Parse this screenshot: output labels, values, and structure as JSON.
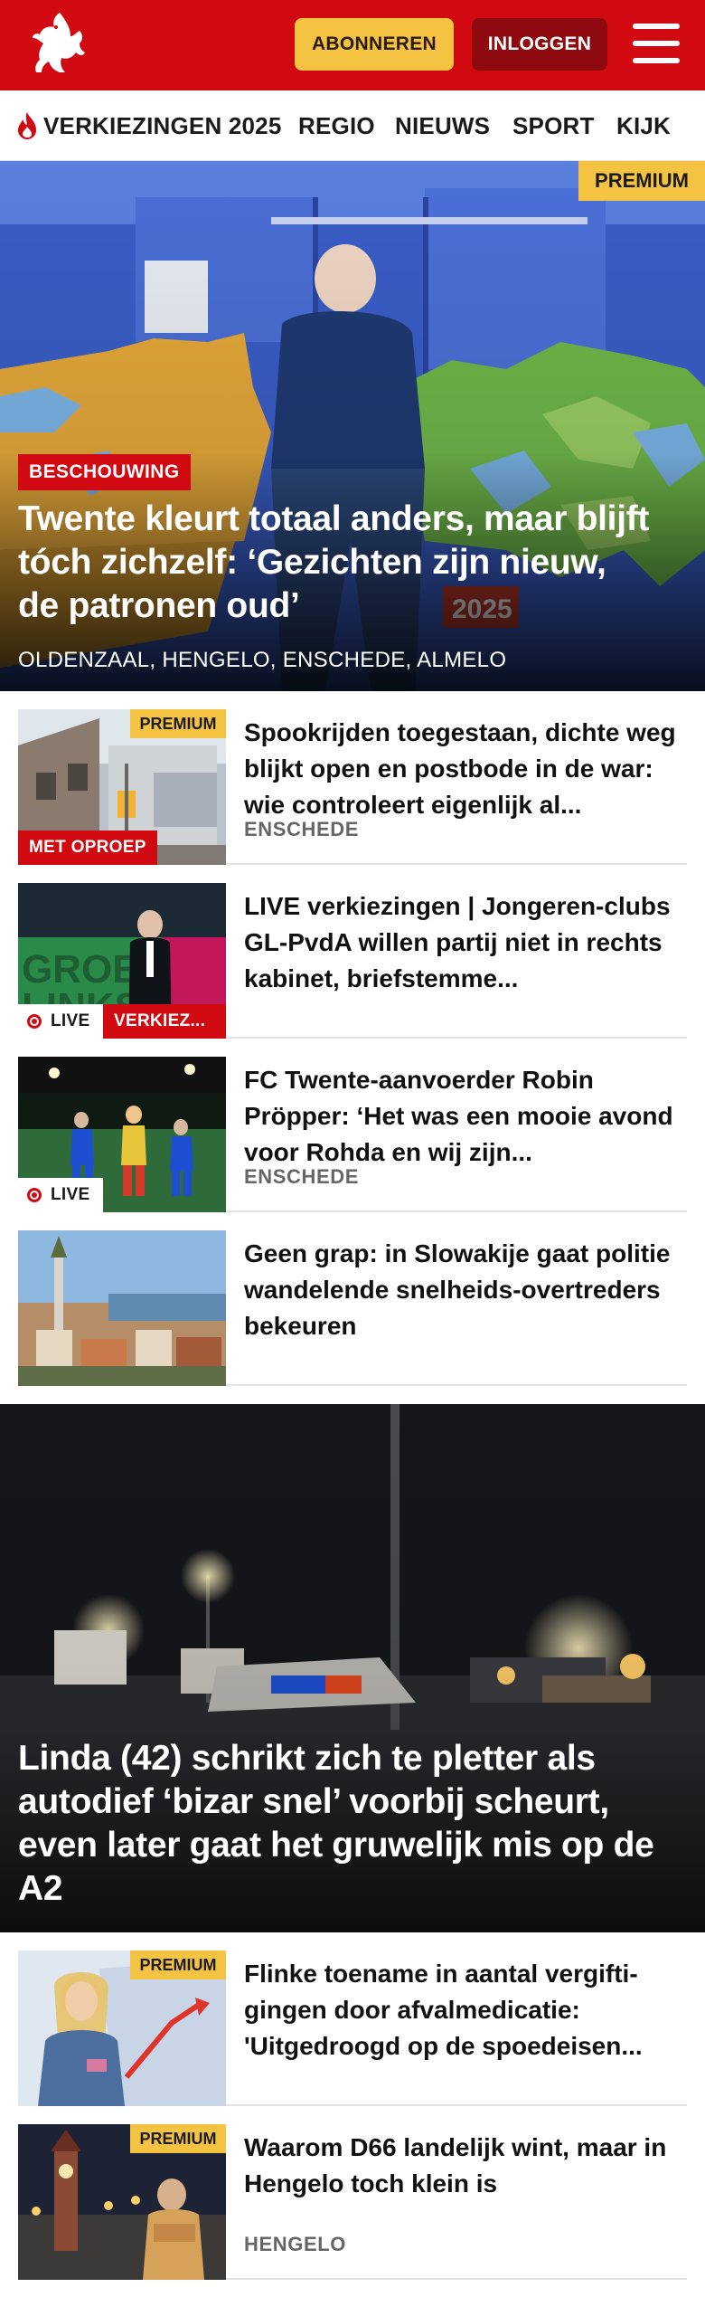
{
  "header": {
    "subscribe_label": "ABONNEREN",
    "login_label": "INLOGGEN",
    "brand_color": "#d10a11",
    "subscribe_color": "#f5c342"
  },
  "nav": {
    "items": [
      {
        "label": "VERKIEZINGEN 2025",
        "icon": "flame-icon"
      },
      {
        "label": "REGIO"
      },
      {
        "label": "NIEUWS"
      },
      {
        "label": "SPORT"
      },
      {
        "label": "KIJK"
      }
    ]
  },
  "hero": {
    "premium_label": "PREMIUM",
    "category_label": "BESCHOUWING",
    "title": "Twente kleurt totaal anders, maar blijft tóch zichzelf: ‘Gezichten zijn nieuw, de patronen oud’",
    "locations": "OLDENZAAL, HENGELO, ENSCHEDE, ALMELO"
  },
  "articles": [
    {
      "title": "Spookrijden toegestaan, dichte weg blijkt open en postbode in de war: wie controleert eigenlijk al...",
      "location": "ENSCHEDE",
      "premium_label": "PREMIUM",
      "badge": "MET OPROEP"
    },
    {
      "title": "LIVE verkiezingen | Jongeren-clubs GL-PvdA willen partij niet in rechts kabinet, briefstemme...",
      "live_label": "LIVE",
      "badge": "VERKIEZ..."
    },
    {
      "title": "FC Twente-aanvoerder Robin Pröpper: ‘Het was een mooie avond voor Rohda en wij zijn...",
      "location": "ENSCHEDE",
      "live_label": "LIVE"
    },
    {
      "title": "Geen grap: in Slowakije gaat politie wandelende snelheids-overtreders bekeuren"
    }
  ],
  "big_story": {
    "title": "Linda (42) schrikt zich te pletter als autodief ‘bizar snel’ voorbij scheurt, even later gaat het gruwelijk mis op de A2"
  },
  "articles_2": [
    {
      "title": "Flinke toename in aantal vergifti-gingen door afvalmedicatie: 'Uitgedroogd op de spoedeisen...",
      "premium_label": "PREMIUM"
    },
    {
      "title": "Waarom D66 landelijk wint, maar in Hengelo toch klein is",
      "location": "HENGELO",
      "premium_label": "PREMIUM"
    }
  ],
  "hero_image_text": "2025"
}
